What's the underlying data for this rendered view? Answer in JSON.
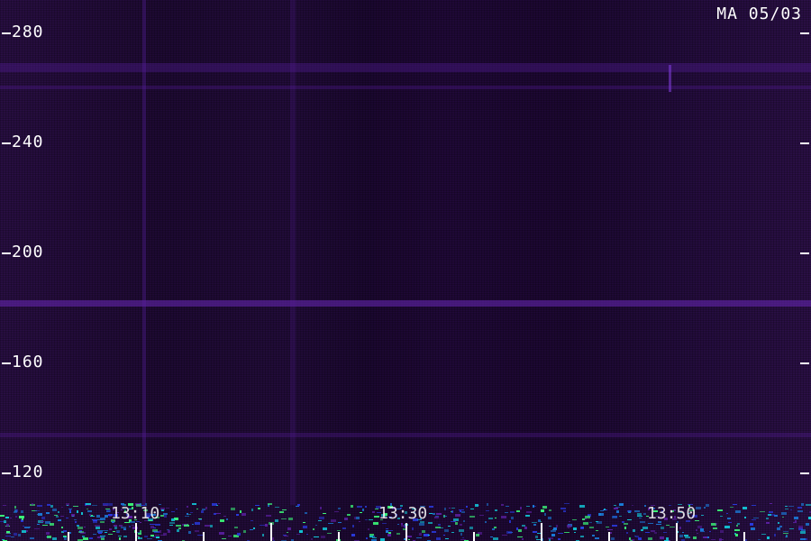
{
  "header": {
    "station_date": "MA 05/03"
  },
  "y_axis": {
    "ticks": [
      "280",
      "240",
      "200",
      "160",
      "120"
    ]
  },
  "x_axis": {
    "ticks": [
      "13:10",
      "13:30",
      "13:50"
    ]
  },
  "colors": {
    "background": "#1f0a35",
    "band": "#5a1fa0",
    "noise_low": "#12c8d8",
    "noise_high": "#3cff7a",
    "text": "#ffffff"
  }
}
